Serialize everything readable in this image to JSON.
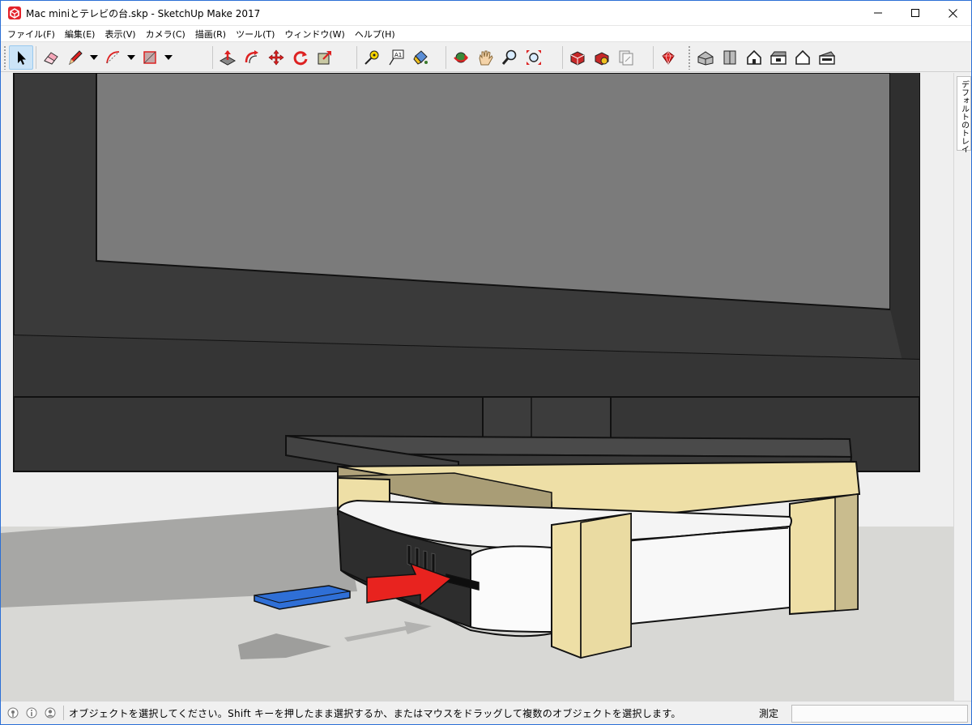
{
  "window": {
    "title": "Mac miniとテレビの台.skp - SketchUp Make 2017",
    "app_icon": "sketchup-logo-icon",
    "controls": [
      "minimize-icon",
      "maximize-icon",
      "close-icon"
    ]
  },
  "menu": [
    {
      "label": "ファイル(F)"
    },
    {
      "label": "編集(E)"
    },
    {
      "label": "表示(V)"
    },
    {
      "label": "カメラ(C)"
    },
    {
      "label": "描画(R)"
    },
    {
      "label": "ツール(T)"
    },
    {
      "label": "ウィンドウ(W)"
    },
    {
      "label": "ヘルプ(H)"
    }
  ],
  "toolbar": {
    "tools": [
      "select-tool-icon",
      "eraser-tool-icon",
      "pencil-line-tool-icon",
      "arc-tool-icon",
      "rectangle-tool-icon",
      "push-pull-tool-icon",
      "offset-tool-icon",
      "move-tool-icon",
      "rotate-tool-icon",
      "scale-tool-icon",
      "tape-measure-tool-icon",
      "text-tool-icon",
      "paint-bucket-tool-icon",
      "orbit-tool-icon",
      "pan-tool-icon",
      "zoom-tool-icon",
      "zoom-extents-tool-icon",
      "3d-warehouse-icon",
      "extension-warehouse-icon",
      "layout-icon",
      "extension-manager-icon",
      "iso-view-icon",
      "top-view-icon",
      "front-view-icon",
      "right-view-icon",
      "back-view-icon",
      "left-view-icon"
    ],
    "text_tool_glyph": "A1",
    "active_tool": "select-tool-icon"
  },
  "colors": {
    "accent_red": "#e8231f",
    "marker_blue": "#2f6fd6",
    "tv_body": "#3a3a3a",
    "tv_screen": "#7b7b7b",
    "stand_wood": "#f0dfa6",
    "mac_white": "#f4f4f4"
  },
  "tray": {
    "label": "デフォルトのトレイ"
  },
  "status": {
    "icons": [
      "geo-location-icon",
      "credits-icon",
      "account-icon"
    ],
    "message": "オブジェクトを選択してください。Shift キーを押したまま選択するか、またはマウスをドラッグして複数のオブジェクトを選択します。",
    "measure_label": "測定",
    "measure_value": ""
  }
}
